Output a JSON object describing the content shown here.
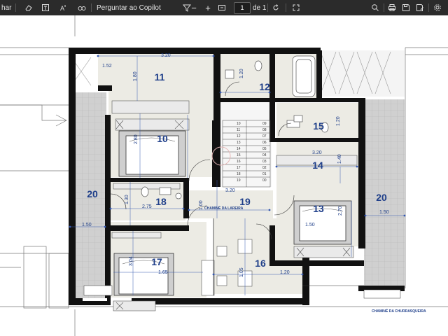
{
  "toolbar": {
    "truncated_label": "har",
    "copilot_label": "Perguntar ao Copilot",
    "minus": "−",
    "plus": "+",
    "page_current": "1",
    "page_of": "de 1",
    "icons": [
      "eraser-icon",
      "text-box-icon",
      "read-aloud-icon",
      "immersive-reader-icon",
      "minus-icon",
      "plus-icon",
      "fit-page-icon",
      "rotate-icon",
      "fullscreen-icon",
      "search-icon",
      "print-icon",
      "save-icon",
      "save-as-icon",
      "settings-icon"
    ]
  },
  "plan": {
    "rooms": [
      {
        "id": "11",
        "label": "11"
      },
      {
        "id": "12",
        "label": "12"
      },
      {
        "id": "10",
        "label": "10"
      },
      {
        "id": "15",
        "label": "15"
      },
      {
        "id": "14",
        "label": "14"
      },
      {
        "id": "20a",
        "label": "20"
      },
      {
        "id": "20b",
        "label": "20"
      },
      {
        "id": "18",
        "label": "18"
      },
      {
        "id": "19",
        "label": "19"
      },
      {
        "id": "13",
        "label": "13"
      },
      {
        "id": "17",
        "label": "17"
      },
      {
        "id": "16",
        "label": "16"
      }
    ],
    "dimensions": [
      "1.80",
      "3.20",
      "1.20",
      "2.80",
      "1.20",
      "3.20",
      "1.40",
      "2.70",
      "1.50",
      "1.50",
      "1.30",
      "2.75",
      "1.00",
      "3.20",
      "1.20",
      "3.04",
      "1.65",
      "1.05",
      "1.50",
      "1.52"
    ],
    "notes": {
      "laundry_chimney": "CHAMINÉ DA LAREIRA",
      "bbq_chimney": "CHAMINÉ DA CHURRASQUEIRA"
    },
    "stairs_left": [
      "10",
      "11",
      "12",
      "13",
      "14",
      "15",
      "16",
      "17",
      "18",
      "19"
    ],
    "stairs_right": [
      "09",
      "08",
      "07",
      "06",
      "05",
      "04",
      "03",
      "02",
      "01",
      "00"
    ]
  }
}
